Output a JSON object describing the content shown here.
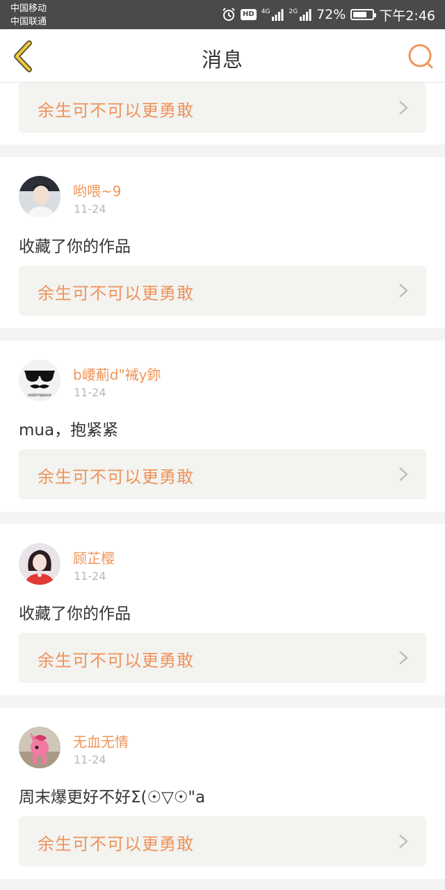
{
  "status_bar": {
    "carrier_1": "中国移动",
    "carrier_2": "中国联通",
    "network_1": "4G",
    "network_2": "2G",
    "battery": "72%",
    "battery_level": 0.72,
    "time": "下午2:46",
    "hd_label": "HD",
    "icons": [
      "alarm-icon",
      "hd-icon",
      "signal-icon",
      "battery-icon"
    ]
  },
  "header": {
    "title": "消息",
    "back_icon": "chevron-left-icon",
    "search_icon": "search-icon"
  },
  "top_partial": {
    "work_title": "余生可不可以更勇敢"
  },
  "messages": [
    {
      "username": "哟喂~9",
      "date": "11-24",
      "text": "收藏了你的作品",
      "work_title": "余生可不可以更勇敢",
      "avatar": "boy-portrait"
    },
    {
      "username": "b崾葪d\"裓y鉨",
      "date": "11-24",
      "text": "mua，抱紧紧",
      "work_title": "余生可不可以更勇敢",
      "avatar": "sunglasses-mustache",
      "avatar_text": "outerspace"
    },
    {
      "username": "顾芷樱",
      "date": "11-24",
      "text": "收藏了你的作品",
      "work_title": "余生可不可以更勇敢",
      "avatar": "girl-portrait"
    },
    {
      "username": "无血无情",
      "date": "11-24",
      "text": "周末爆更好不好Σ(☉▽☉\"a",
      "work_title": "余生可不可以更勇敢",
      "avatar": "pink-pony-toy"
    }
  ],
  "colors": {
    "accent": "#f0955a",
    "status_bar": "#4a4a4a",
    "link_bg": "#f3f3ef",
    "page_bg": "#f4f4f4"
  }
}
